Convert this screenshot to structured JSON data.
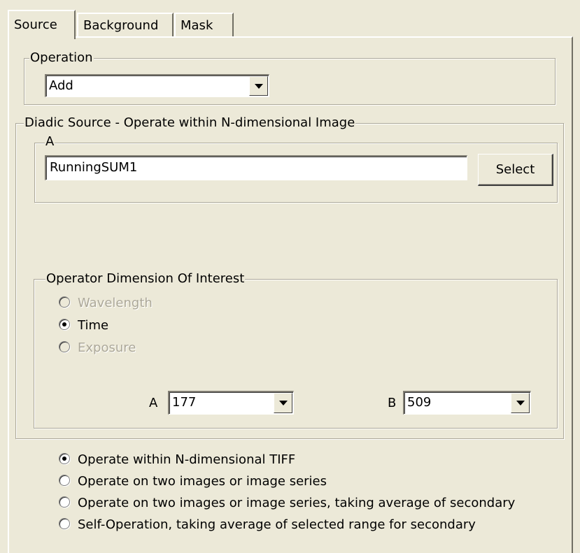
{
  "tabs": [
    {
      "label": "Source",
      "active": true
    },
    {
      "label": "Background",
      "active": false
    },
    {
      "label": "Mask",
      "active": false
    }
  ],
  "operation": {
    "legend": "Operation",
    "selected": "Add"
  },
  "diadic": {
    "legend": "Diadic Source - Operate within N-dimensional Image",
    "a_group": {
      "legend": "A",
      "value": "RunningSUM1",
      "select_label": "Select"
    },
    "dimension": {
      "legend": "Operator Dimension Of Interest",
      "options": [
        {
          "label": "Wavelength",
          "checked": false,
          "enabled": false
        },
        {
          "label": "Time",
          "checked": true,
          "enabled": true
        },
        {
          "label": "Exposure",
          "checked": false,
          "enabled": false
        }
      ],
      "a_label": "A",
      "a_value": "177",
      "b_label": "B",
      "b_value": "509"
    }
  },
  "modes": [
    {
      "label": "Operate within N-dimensional TIFF",
      "checked": true
    },
    {
      "label": "Operate on two images or image series",
      "checked": false
    },
    {
      "label": "Operate on two images or image series, taking average of secondary",
      "checked": false
    },
    {
      "label": "Self-Operation, taking average of selected range for secondary",
      "checked": false
    }
  ],
  "colors": {
    "face": "#ece9d8",
    "group_border": "#aca899",
    "disabled_text": "#aca899"
  },
  "icons": {
    "dropdown": "chevron-down-icon",
    "radio": "radio-dot-icon"
  }
}
